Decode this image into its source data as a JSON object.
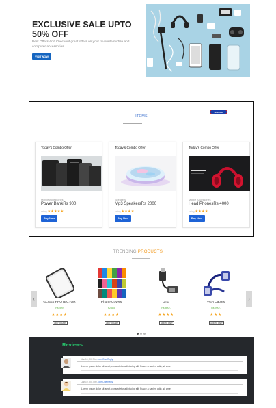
{
  "hero": {
    "title": "EXCLUSIVE SALE UPTO 50% OFF",
    "subtitle": "Best Offers And Checkout great offers on your favourite mobile and computer accessories.",
    "button": "VISIT NOW"
  },
  "items": {
    "heading": "ITEMS",
    "badge": "SPECIAL",
    "cards": [
      {
        "heading": "Today's Combo Offer",
        "category": "Mobile Accessories",
        "name": "Power BankRs 900",
        "rating_label": "rating",
        "stars": "★★★★★",
        "button": "Buy Now"
      },
      {
        "heading": "Today's Combo Offer",
        "category": "Speakers",
        "name": "Mp3 SpeakersRs 2000",
        "rating_label": "rating",
        "stars": "★★★★",
        "button": "Buy Now"
      },
      {
        "heading": "Today's Combo Offer",
        "category": "Mobile Accessories",
        "name": "Head PhonesRs 4000",
        "rating_label": "rating",
        "stars": "★★★★",
        "button": "Buy Now"
      }
    ]
  },
  "trending": {
    "title_plain": "TRENDING ",
    "title_accent": "PRODUCTS",
    "prev_arrow": "‹",
    "next_arrow": "›",
    "products": [
      {
        "name": "GLASS PROTECTOR",
        "price": "Rs.499",
        "stars": "★★★★",
        "cart": "ADD TO CART"
      },
      {
        "name": "Phone Covers",
        "price": "$2385",
        "stars": "★★★★",
        "cart": "ADD TO CART"
      },
      {
        "name": "OTG",
        "price": "Rs.800/-",
        "stars": "★★★★",
        "cart": "ADD TO CART"
      },
      {
        "name": "VGA Cables",
        "price": "Rs.990/-",
        "stars": "★★★",
        "cart": "ADD TO CART"
      }
    ]
  },
  "reviews": {
    "title": "Reviews",
    "items": [
      {
        "date": "Jan 10, 2017",
        "author_prefix": "by",
        "author": "John Doe",
        "comments": "Reply",
        "text": "Lorem ipsum dolor sit amet, consectetur adipiscing elit. Fusce a sapien odio, sit amet"
      },
      {
        "date": "Jan 10, 2017",
        "author_prefix": "by",
        "author": "John Doe",
        "comments": "Reply",
        "text": "Lorem ipsum dolor sit amet, consectetur adipiscing elit. Fusce a sapien odio, sit amet"
      }
    ]
  },
  "colors": {
    "primary_button": "#1e63d6",
    "trending_accent": "#f29a1f",
    "reviews_bg": "#25282c",
    "reviews_title": "#27c26b",
    "stars": "#f5a623"
  }
}
